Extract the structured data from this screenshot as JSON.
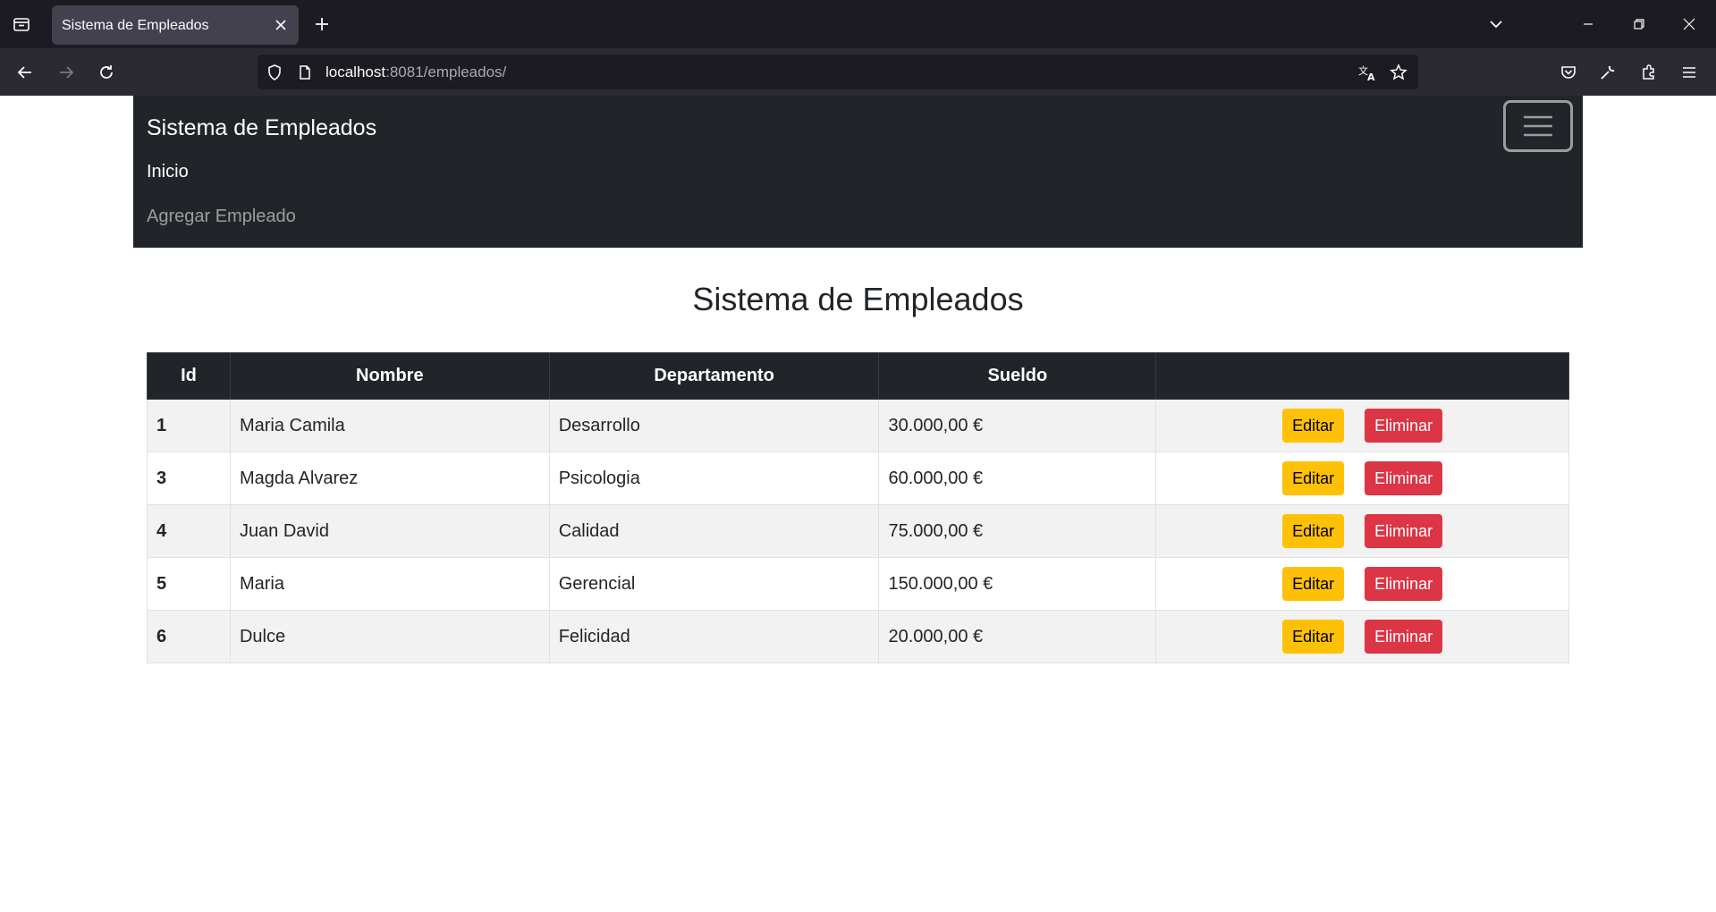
{
  "browser": {
    "tab_title": "Sistema de Empleados",
    "url_host": "localhost",
    "url_rest": ":8081/empleados/",
    "colors": {
      "tabbar": "#1c1b22",
      "toolbar": "#2b2a33",
      "active_tab": "#42414d"
    }
  },
  "navbar": {
    "brand": "Sistema de Empleados",
    "links": [
      {
        "label": "Inicio",
        "active": true
      },
      {
        "label": "Agregar Empleado",
        "active": false
      }
    ],
    "toggler_icon": "hamburger-icon"
  },
  "page": {
    "title": "Sistema de Empleados"
  },
  "table": {
    "headers": [
      "Id",
      "Nombre",
      "Departamento",
      "Sueldo",
      ""
    ],
    "rows": [
      {
        "id": "1",
        "nombre": "Maria Camila",
        "departamento": "Desarrollo",
        "sueldo": "30.000,00 €"
      },
      {
        "id": "3",
        "nombre": "Magda Alvarez",
        "departamento": "Psicologia",
        "sueldo": "60.000,00 €"
      },
      {
        "id": "4",
        "nombre": "Juan David",
        "departamento": "Calidad",
        "sueldo": "75.000,00 €"
      },
      {
        "id": "5",
        "nombre": "Maria",
        "departamento": "Gerencial",
        "sueldo": "150.000,00 €"
      },
      {
        "id": "6",
        "nombre": "Dulce",
        "departamento": "Felicidad",
        "sueldo": "20.000,00 €"
      }
    ],
    "edit_label": "Editar",
    "delete_label": "Eliminar",
    "colors": {
      "header": "#212529",
      "edit": "#ffc107",
      "delete": "#dc3545",
      "stripe": "#f2f2f2"
    }
  }
}
